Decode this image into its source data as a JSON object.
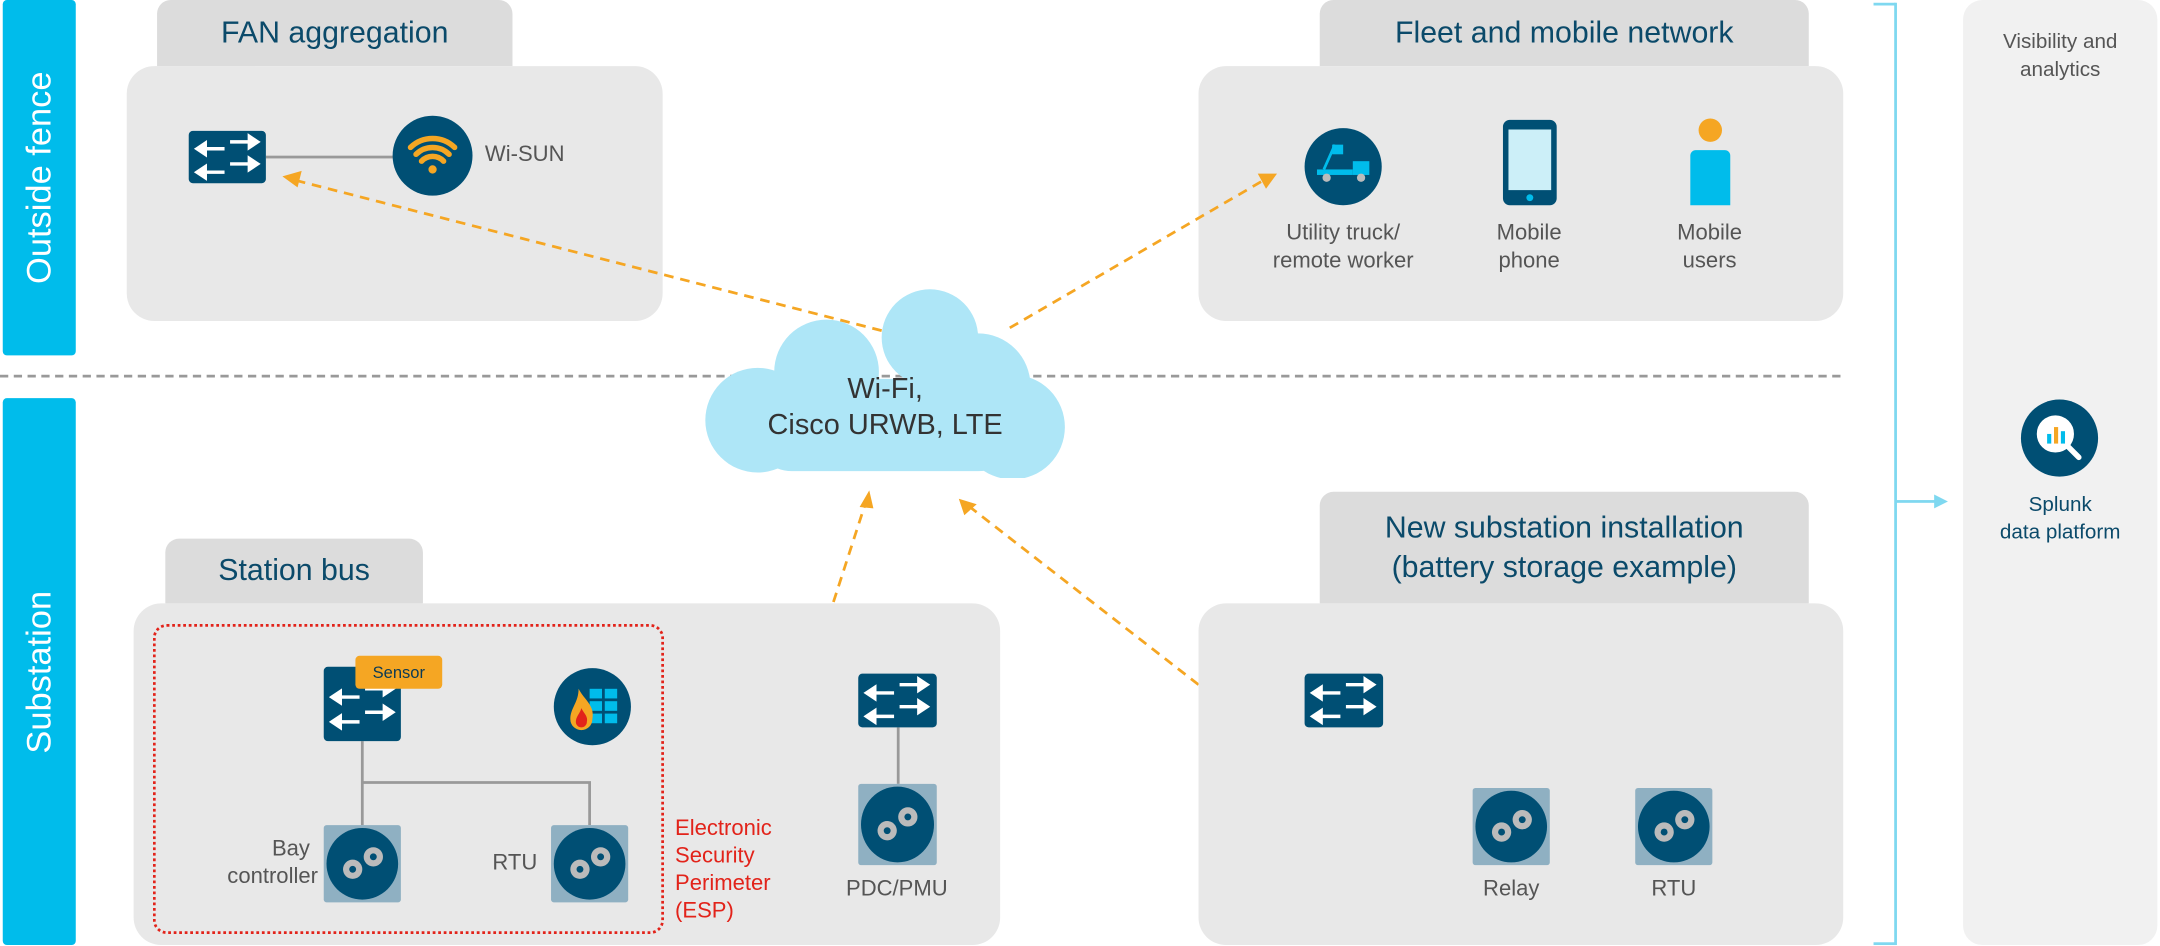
{
  "zones": {
    "outside_fence": "Outside fence",
    "substation": "Substation"
  },
  "fan": {
    "title": "FAN aggregation",
    "wisun": "Wi-SUN"
  },
  "fleet": {
    "title": "Fleet and mobile network",
    "truck": [
      "Utility truck/",
      "remote worker"
    ],
    "phone": [
      "Mobile",
      "phone"
    ],
    "users": [
      "Mobile",
      "users"
    ]
  },
  "cloud": {
    "line1": "Wi-Fi,",
    "line2": "Cisco URWB, LTE"
  },
  "station": {
    "title": "Station bus",
    "sensor": "Sensor",
    "bay": [
      "Bay",
      "controller"
    ],
    "rtu": "RTU",
    "esp": [
      "Electronic",
      "Security",
      "Perimeter",
      "(ESP)"
    ],
    "pdc": "PDC/PMU"
  },
  "newsub": {
    "title": [
      "New substation installation",
      "(battery storage example)"
    ],
    "relay": "Relay",
    "rtu": "RTU"
  },
  "analytics": {
    "title": [
      "Visibility and",
      "analytics"
    ],
    "splunk": [
      "Splunk",
      "data platform"
    ]
  },
  "colors": {
    "accent": "#00bceb",
    "dark_blue": "#004f74",
    "link": "#f5a623",
    "esp": "#e2231a"
  }
}
